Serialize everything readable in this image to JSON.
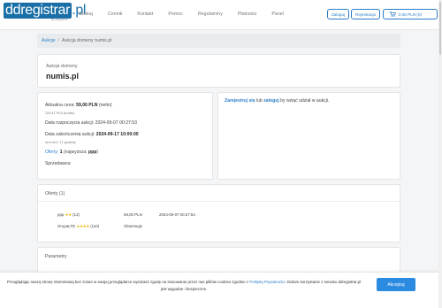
{
  "header": {
    "logo_box": "ddregistrar",
    "logo_suffix": ".pl",
    "logo_sub": "By ddregistrar",
    "nav": [
      "Szukaj",
      "Cennik",
      "Kontakt",
      "Pomoc",
      "Regulaminy",
      "Płatności",
      "Panel"
    ],
    "login_label": "Zaloguj",
    "register_label": "Rejestracja",
    "cart_label": "0,00 PLN (0)"
  },
  "breadcrumb": {
    "root": "Aukcje",
    "separator": "/",
    "current": "Aukcja domeny numis.pl"
  },
  "domain": {
    "label": "Aukcja domeny",
    "name": "numis.pl"
  },
  "info": {
    "current_price_label": "Aktualna cena:",
    "current_price_value": "59,00 PLN",
    "current_price_net": "(netto)",
    "current_price_gross": "109,47 PLN (brutto)",
    "start_label": "Data rozpoczęcia aukcji:",
    "start_value": "2024-09-07 00:27:53",
    "end_label": "Data zakończenia aukcji:",
    "end_value": "2024-09-17 10:00:00",
    "remaining": "za 6 dni i 17 godziny",
    "offers_label": "Oferty:",
    "offers_count": "1",
    "highest_label": "(najwyższa:",
    "highest_user": "ppp",
    "highest_close": ")",
    "seller_label": "Sprzedawca:"
  },
  "register_prompt": {
    "link1": "Zarejestruj się",
    "mid": " lub ",
    "link2": "zaloguj",
    "tail": " by wziąć udział w aukcji."
  },
  "offers": {
    "title": "Oferty (1)",
    "rows": [
      {
        "user": "ppp",
        "stars": "★★",
        "rating": "(13)",
        "amount": "59,00 PLN",
        "date": "2024-09-07 00:27:53"
      },
      {
        "user": "GrupaLTD",
        "stars": "★★★★",
        "rating": "(110)",
        "amount": "Obserwuje",
        "date": ""
      }
    ]
  },
  "params": {
    "title": "Parametry"
  },
  "cookie": {
    "text1": "Przeglądając naszą stronę internetową bez zmian w swojej przeglądarce wyrażasz zgodę na stosowanie przez nas plików cookies zgodnie z ",
    "link": "Polityką Prywatności",
    "text2": ". Dalsze korzystanie z serwisu ddregistrar.pl jest wygodne i bezpieczne.",
    "accept": "Akceptuj"
  },
  "colors": {
    "accent": "#2a7cc7",
    "star": "#e9b400",
    "cookie_button": "#2a8be0"
  }
}
